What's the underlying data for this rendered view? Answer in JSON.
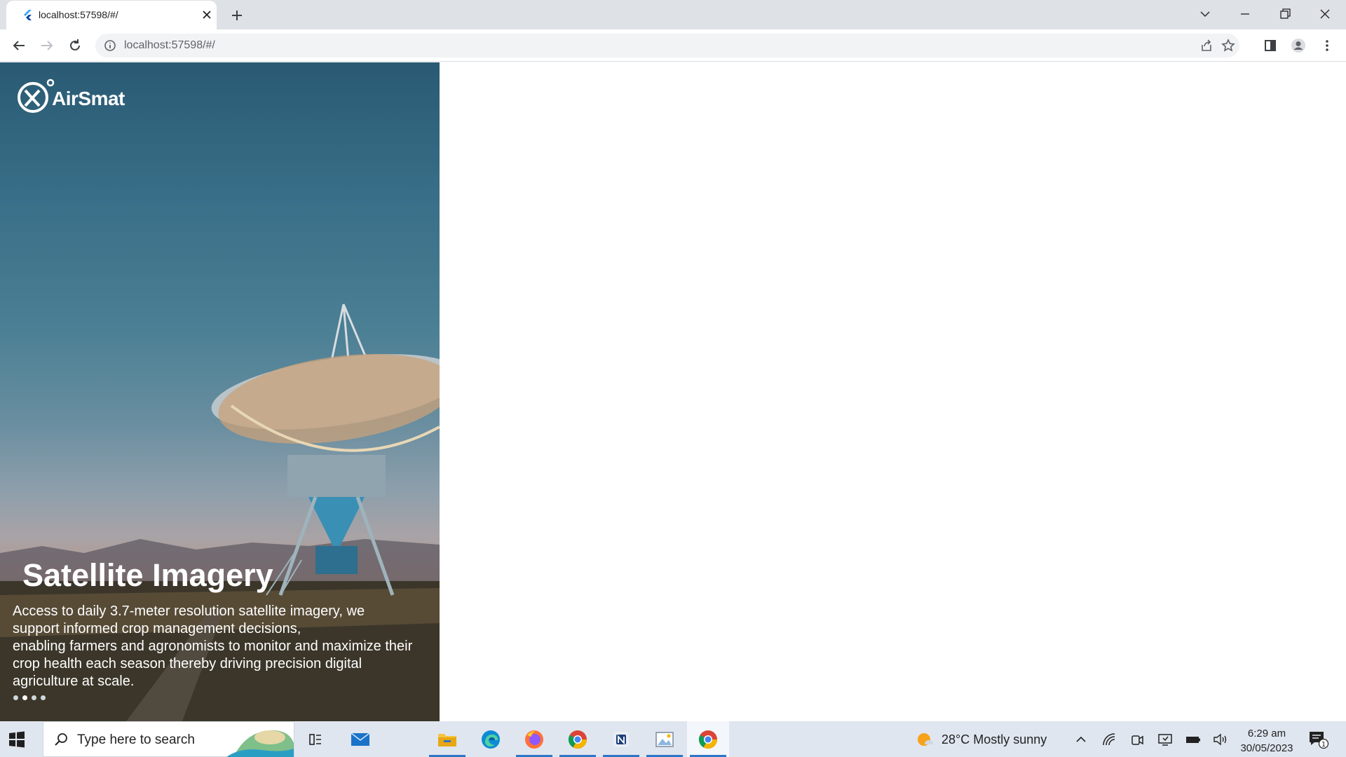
{
  "browser": {
    "tab_title": "localhost:57598/#/",
    "url": "localhost:57598/#/"
  },
  "hero": {
    "brand": "AirSmat",
    "title": "Satellite Imagery",
    "description_lines": [
      "Access to daily 3.7-meter resolution satellite imagery, we",
      "support informed crop management decisions,",
      "enabling farmers and agronomists to monitor and maximize their",
      "crop health each season thereby driving precision digital",
      "agriculture at scale."
    ],
    "carousel": {
      "count": 4,
      "active_index": 1
    }
  },
  "taskbar": {
    "search_placeholder": "Type here to search",
    "weather": "28°C  Mostly sunny",
    "time": "6:29 am",
    "date": "30/05/2023",
    "notification_count": "1",
    "apps": [
      "task-view",
      "mail",
      "file-explorer",
      "edge",
      "firefox",
      "chrome",
      "app-n",
      "paint",
      "chrome-active"
    ]
  },
  "colors": {
    "tab_strip": "#dee1e6",
    "taskbar": "#dfe6ef",
    "accent": "#2b76c9"
  }
}
